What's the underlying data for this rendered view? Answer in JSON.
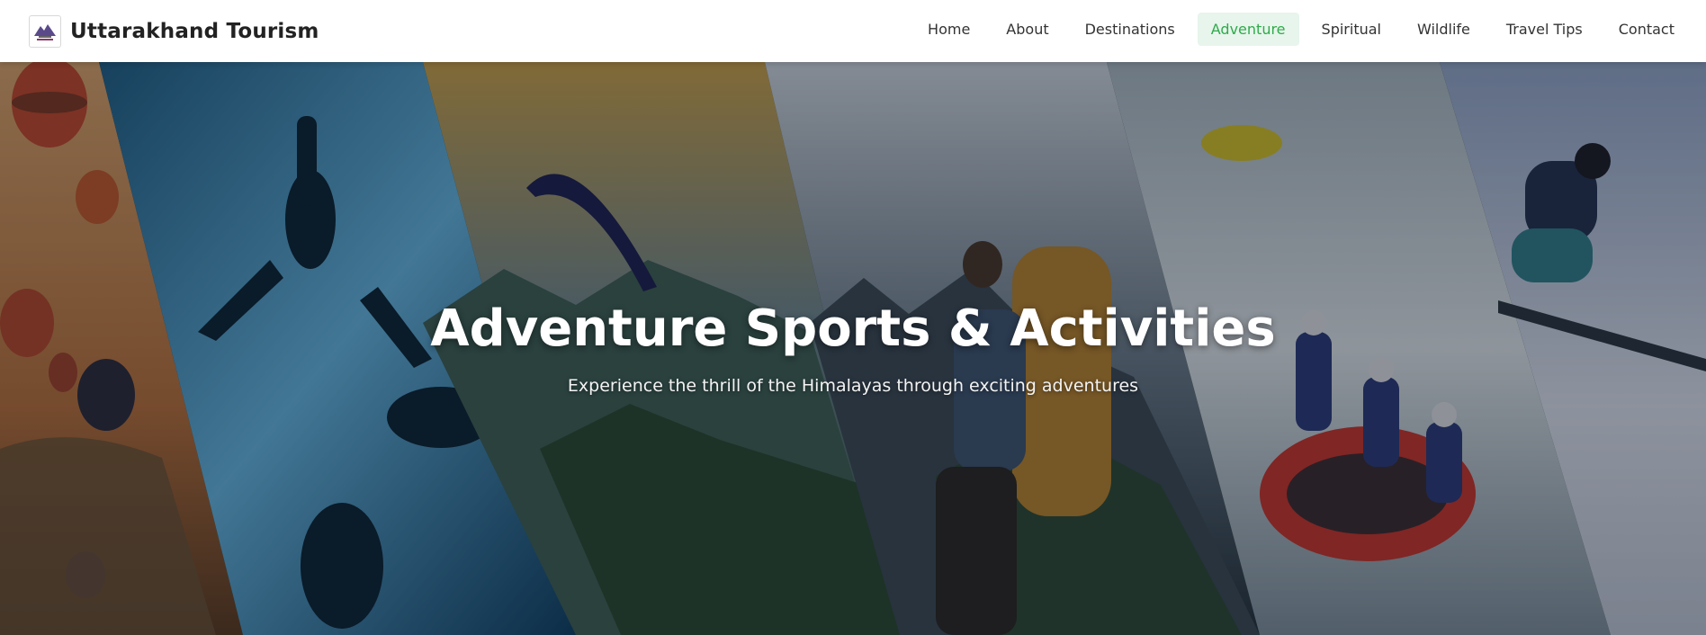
{
  "brand": {
    "name": "Uttarakhand Tourism",
    "logo_icon": "uttarakhand-logo-icon"
  },
  "nav": {
    "items": [
      {
        "label": "Home",
        "active": false
      },
      {
        "label": "About",
        "active": false
      },
      {
        "label": "Destinations",
        "active": false
      },
      {
        "label": "Adventure",
        "active": true
      },
      {
        "label": "Spiritual",
        "active": false
      },
      {
        "label": "Wildlife",
        "active": false
      },
      {
        "label": "Travel Tips",
        "active": false
      },
      {
        "label": "Contact",
        "active": false
      }
    ]
  },
  "hero": {
    "title": "Adventure Sports & Activities",
    "subtitle": "Experience the thrill of the Himalayas through exciting adventures",
    "panels": [
      "hot-air-balloons",
      "scuba-diving",
      "paragliding",
      "trekking",
      "river-rafting",
      "skiing"
    ]
  },
  "colors": {
    "active_nav_bg": "#e7f5ec",
    "active_nav_text": "#2fab4a",
    "nav_bg": "#ffffff"
  }
}
